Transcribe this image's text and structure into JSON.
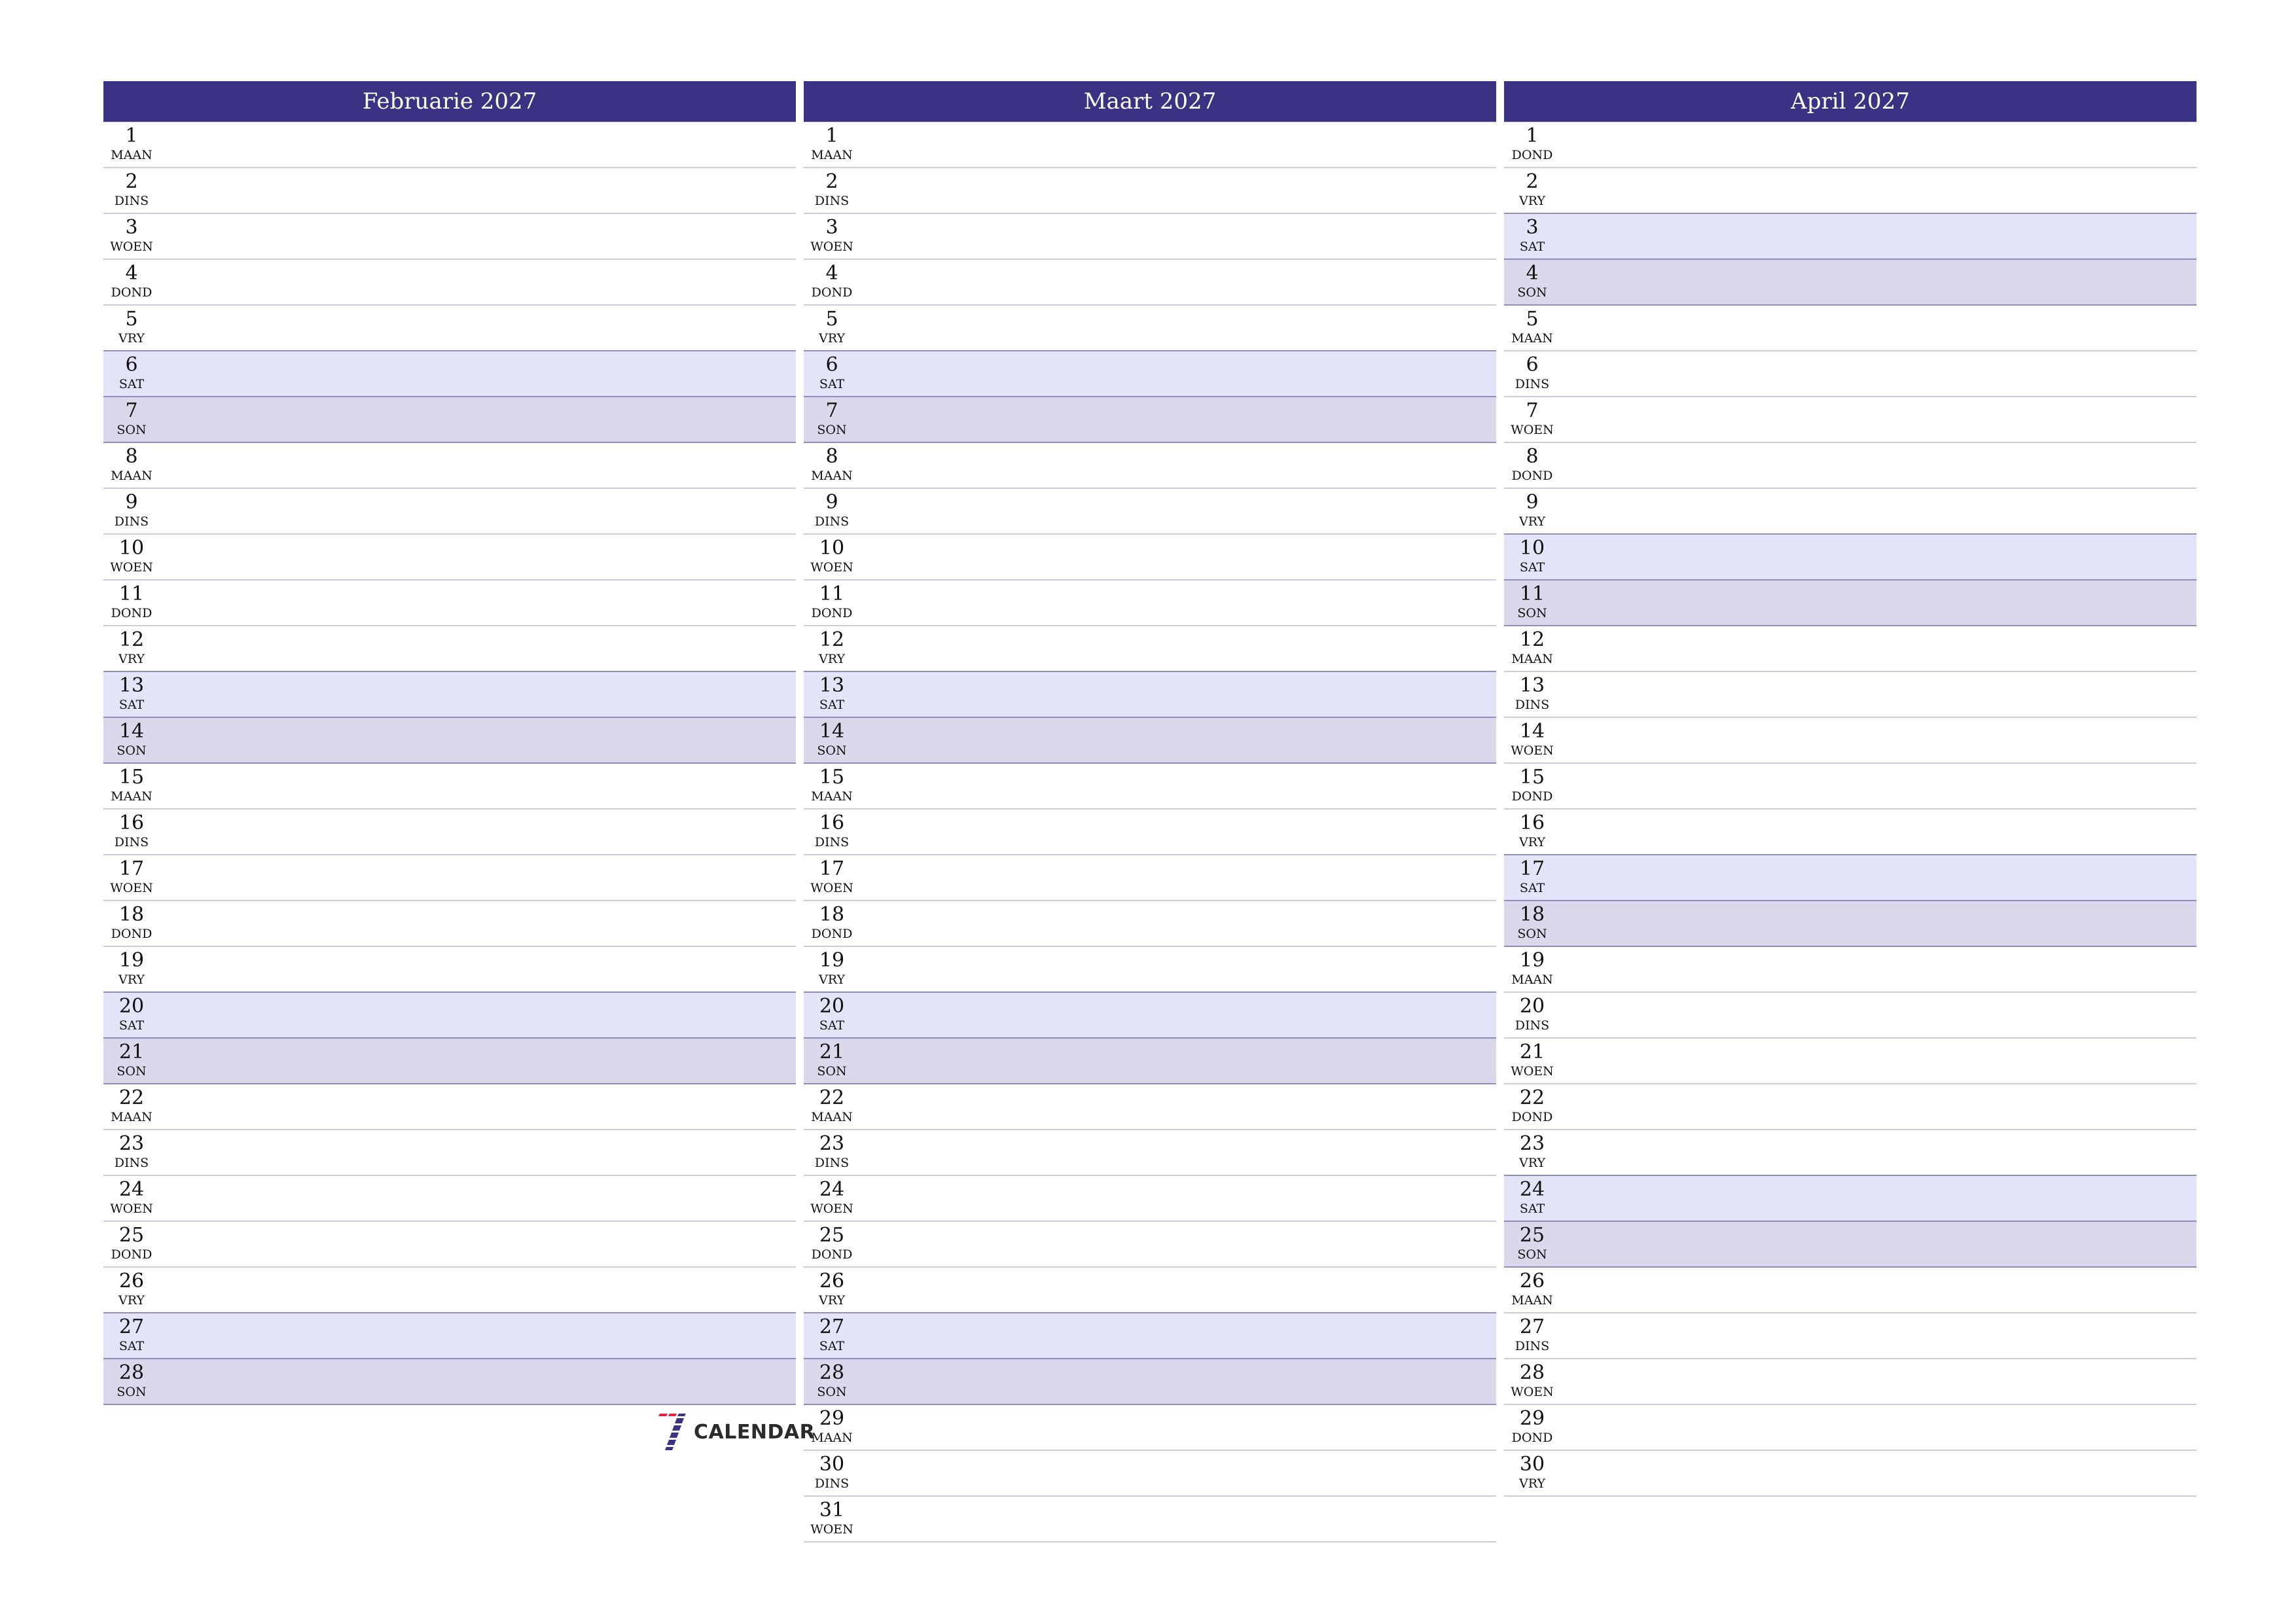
{
  "colors": {
    "header": "#3a3283",
    "saturday": "#e4e4f8",
    "sunday": "#dcd8ec"
  },
  "months": [
    {
      "title": "Februarie 2027",
      "days": [
        {
          "n": "1",
          "d": "MAAN"
        },
        {
          "n": "2",
          "d": "DINS"
        },
        {
          "n": "3",
          "d": "WOEN"
        },
        {
          "n": "4",
          "d": "DOND"
        },
        {
          "n": "5",
          "d": "VRY"
        },
        {
          "n": "6",
          "d": "SAT"
        },
        {
          "n": "7",
          "d": "SON"
        },
        {
          "n": "8",
          "d": "MAAN"
        },
        {
          "n": "9",
          "d": "DINS"
        },
        {
          "n": "10",
          "d": "WOEN"
        },
        {
          "n": "11",
          "d": "DOND"
        },
        {
          "n": "12",
          "d": "VRY"
        },
        {
          "n": "13",
          "d": "SAT"
        },
        {
          "n": "14",
          "d": "SON"
        },
        {
          "n": "15",
          "d": "MAAN"
        },
        {
          "n": "16",
          "d": "DINS"
        },
        {
          "n": "17",
          "d": "WOEN"
        },
        {
          "n": "18",
          "d": "DOND"
        },
        {
          "n": "19",
          "d": "VRY"
        },
        {
          "n": "20",
          "d": "SAT"
        },
        {
          "n": "21",
          "d": "SON"
        },
        {
          "n": "22",
          "d": "MAAN"
        },
        {
          "n": "23",
          "d": "DINS"
        },
        {
          "n": "24",
          "d": "WOEN"
        },
        {
          "n": "25",
          "d": "DOND"
        },
        {
          "n": "26",
          "d": "VRY"
        },
        {
          "n": "27",
          "d": "SAT"
        },
        {
          "n": "28",
          "d": "SON"
        }
      ]
    },
    {
      "title": "Maart 2027",
      "days": [
        {
          "n": "1",
          "d": "MAAN"
        },
        {
          "n": "2",
          "d": "DINS"
        },
        {
          "n": "3",
          "d": "WOEN"
        },
        {
          "n": "4",
          "d": "DOND"
        },
        {
          "n": "5",
          "d": "VRY"
        },
        {
          "n": "6",
          "d": "SAT"
        },
        {
          "n": "7",
          "d": "SON"
        },
        {
          "n": "8",
          "d": "MAAN"
        },
        {
          "n": "9",
          "d": "DINS"
        },
        {
          "n": "10",
          "d": "WOEN"
        },
        {
          "n": "11",
          "d": "DOND"
        },
        {
          "n": "12",
          "d": "VRY"
        },
        {
          "n": "13",
          "d": "SAT"
        },
        {
          "n": "14",
          "d": "SON"
        },
        {
          "n": "15",
          "d": "MAAN"
        },
        {
          "n": "16",
          "d": "DINS"
        },
        {
          "n": "17",
          "d": "WOEN"
        },
        {
          "n": "18",
          "d": "DOND"
        },
        {
          "n": "19",
          "d": "VRY"
        },
        {
          "n": "20",
          "d": "SAT"
        },
        {
          "n": "21",
          "d": "SON"
        },
        {
          "n": "22",
          "d": "MAAN"
        },
        {
          "n": "23",
          "d": "DINS"
        },
        {
          "n": "24",
          "d": "WOEN"
        },
        {
          "n": "25",
          "d": "DOND"
        },
        {
          "n": "26",
          "d": "VRY"
        },
        {
          "n": "27",
          "d": "SAT"
        },
        {
          "n": "28",
          "d": "SON"
        },
        {
          "n": "29",
          "d": "MAAN"
        },
        {
          "n": "30",
          "d": "DINS"
        },
        {
          "n": "31",
          "d": "WOEN"
        }
      ]
    },
    {
      "title": "April 2027",
      "days": [
        {
          "n": "1",
          "d": "DOND"
        },
        {
          "n": "2",
          "d": "VRY"
        },
        {
          "n": "3",
          "d": "SAT"
        },
        {
          "n": "4",
          "d": "SON"
        },
        {
          "n": "5",
          "d": "MAAN"
        },
        {
          "n": "6",
          "d": "DINS"
        },
        {
          "n": "7",
          "d": "WOEN"
        },
        {
          "n": "8",
          "d": "DOND"
        },
        {
          "n": "9",
          "d": "VRY"
        },
        {
          "n": "10",
          "d": "SAT"
        },
        {
          "n": "11",
          "d": "SON"
        },
        {
          "n": "12",
          "d": "MAAN"
        },
        {
          "n": "13",
          "d": "DINS"
        },
        {
          "n": "14",
          "d": "WOEN"
        },
        {
          "n": "15",
          "d": "DOND"
        },
        {
          "n": "16",
          "d": "VRY"
        },
        {
          "n": "17",
          "d": "SAT"
        },
        {
          "n": "18",
          "d": "SON"
        },
        {
          "n": "19",
          "d": "MAAN"
        },
        {
          "n": "20",
          "d": "DINS"
        },
        {
          "n": "21",
          "d": "WOEN"
        },
        {
          "n": "22",
          "d": "DOND"
        },
        {
          "n": "23",
          "d": "VRY"
        },
        {
          "n": "24",
          "d": "SAT"
        },
        {
          "n": "25",
          "d": "SON"
        },
        {
          "n": "26",
          "d": "MAAN"
        },
        {
          "n": "27",
          "d": "DINS"
        },
        {
          "n": "28",
          "d": "WOEN"
        },
        {
          "n": "29",
          "d": "DOND"
        },
        {
          "n": "30",
          "d": "VRY"
        }
      ]
    }
  ],
  "logo": {
    "text": "CALENDAR",
    "icon": "seven-logo-icon"
  }
}
